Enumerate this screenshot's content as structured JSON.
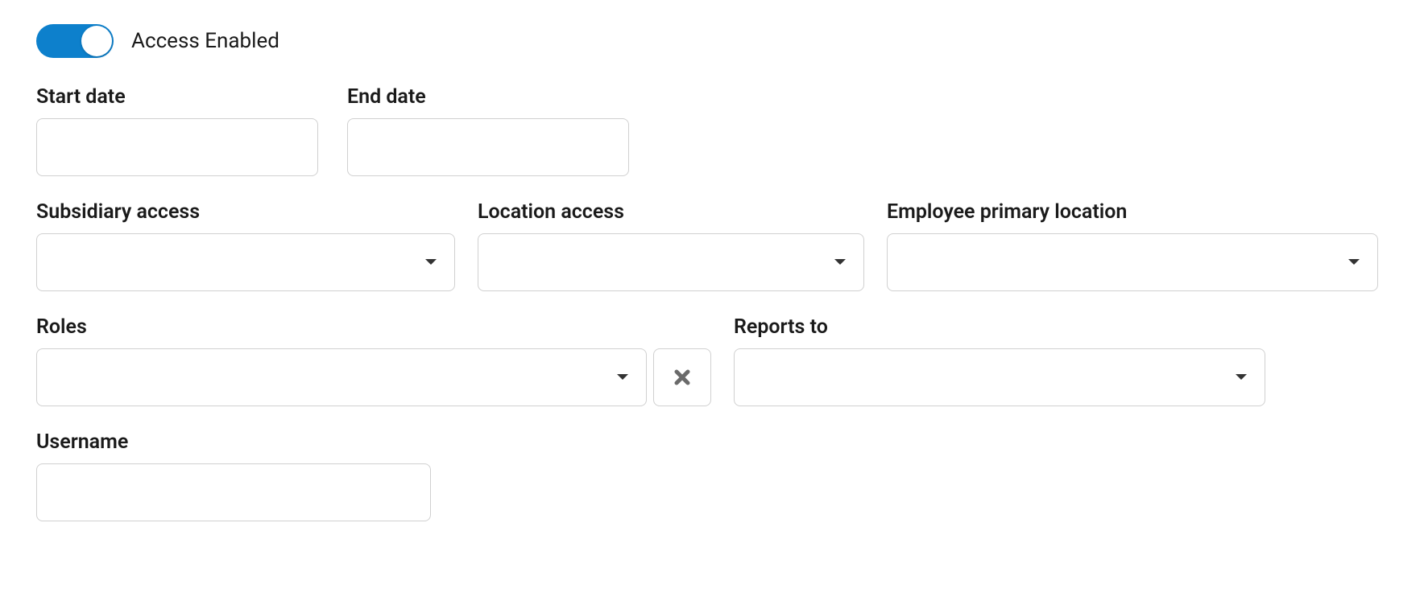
{
  "toggle": {
    "label": "Access Enabled",
    "state": "on"
  },
  "fields": {
    "start_date": {
      "label": "Start date",
      "value": ""
    },
    "end_date": {
      "label": "End date",
      "value": ""
    },
    "subsidiary_access": {
      "label": "Subsidiary access",
      "value": ""
    },
    "location_access": {
      "label": "Location access",
      "value": ""
    },
    "employee_primary_location": {
      "label": "Employee primary location",
      "value": ""
    },
    "roles": {
      "label": "Roles",
      "value": ""
    },
    "reports_to": {
      "label": "Reports to",
      "value": ""
    },
    "username": {
      "label": "Username",
      "value": ""
    }
  },
  "icons": {
    "caret_down": "caret-down-icon",
    "clear": "close-icon"
  }
}
